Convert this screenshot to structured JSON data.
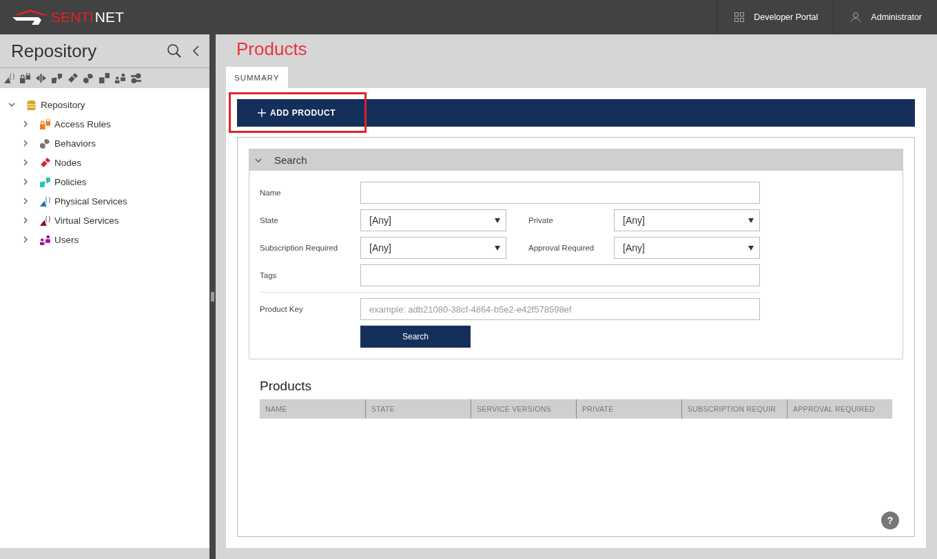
{
  "logo": {
    "first": "SENTI",
    "second": "NET"
  },
  "header_links": [
    {
      "kind": "grid",
      "label": "Developer Portal"
    },
    {
      "kind": "user",
      "label": "Administrator"
    }
  ],
  "sidebar": {
    "title": "Repository",
    "tree": [
      {
        "label": "Repository",
        "kind": "database",
        "color": "#d4a72c",
        "expanded": true,
        "children": [
          {
            "label": "Access Rules",
            "kind": "lock",
            "color": "#f07a1a",
            "expanded": false
          },
          {
            "label": "Behaviors",
            "kind": "behavior",
            "color": "#777777",
            "expanded": false
          },
          {
            "label": "Nodes",
            "kind": "node",
            "color": "#e0242f",
            "expanded": false
          },
          {
            "label": "Policies",
            "kind": "policy",
            "color": "#22c4b8",
            "expanded": false
          },
          {
            "label": "Physical Services",
            "kind": "service",
            "color": "#1d72c2",
            "expanded": false
          },
          {
            "label": "Virtual Services",
            "kind": "service",
            "color": "#8c1020",
            "expanded": false
          },
          {
            "label": "Users",
            "kind": "users",
            "color": "#a0159e",
            "expanded": false
          }
        ]
      }
    ]
  },
  "page_title": "Products",
  "tabs": [
    {
      "label": "SUMMARY",
      "selected": true
    }
  ],
  "add_product": {
    "label": "ADD PRODUCT",
    "highlighted": true
  },
  "search": {
    "title": "Search",
    "expanded": true,
    "rows": [
      {
        "kind": "text",
        "fields": [
          {
            "label": "Name"
          }
        ]
      },
      {
        "kind": "select",
        "fields": [
          {
            "label": "State",
            "value": "[Any]"
          },
          {
            "label": "Private",
            "value": "[Any]"
          }
        ]
      },
      {
        "kind": "select",
        "fields": [
          {
            "label": "Subscription Required",
            "value": "[Any]"
          },
          {
            "label": "Approval Required",
            "value": "[Any]"
          }
        ]
      },
      {
        "kind": "text",
        "fields": [
          {
            "label": "Tags"
          }
        ]
      },
      {
        "kind": "divider"
      },
      {
        "kind": "text",
        "fields": [
          {
            "label": "Product Key",
            "placeholder": "example: adb21080-38cf-4864-b5e2-e42f578598ef"
          }
        ]
      }
    ],
    "button": "Search"
  },
  "products": {
    "title": "Products",
    "columns": [
      "NAME",
      "STATE",
      "SERVICE VERSIONS",
      "PRIVATE",
      "SUBSCRIPTION REQUIR",
      "APPROVAL REQUIRED"
    ]
  },
  "help": "?"
}
